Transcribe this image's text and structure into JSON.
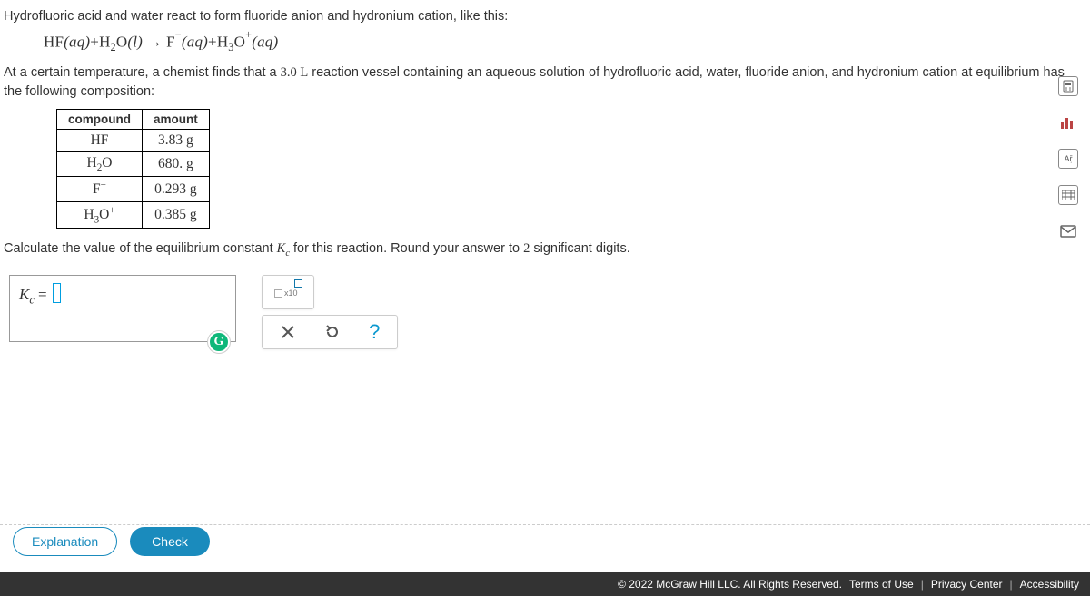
{
  "problem": {
    "intro": "Hydrofluoric acid and water react to form fluoride anion and hydronium cation, like this:",
    "context_pre": "At a certain temperature, a chemist finds that a ",
    "volume": "3.0 L",
    "context_post": " reaction vessel containing an aqueous solution of hydrofluoric acid, water, fluoride anion, and hydronium cation at equilibrium has the following composition:",
    "calc_pre": "Calculate the value of the equilibrium constant ",
    "calc_post": " for this reaction. Round your answer to ",
    "sigdig": "2",
    "calc_end": " significant digits."
  },
  "equation": {
    "r1": "HF",
    "r1_state": "(aq)",
    "plus": "+",
    "r2": "H",
    "r2_sub": "2",
    "r2b": "O",
    "r2_state": "(l)",
    "arrow": "→",
    "p1": "F",
    "p1_sup": "−",
    "p1_state": "(aq)",
    "p2": "H",
    "p2_sub": "3",
    "p2b": "O",
    "p2_sup": "+",
    "p2_state": "(aq)"
  },
  "table": {
    "h1": "compound",
    "h2": "amount",
    "rows": [
      {
        "c": "HF",
        "a": "3.83 g"
      },
      {
        "c": "H2O",
        "a": "680. g"
      },
      {
        "c": "F-",
        "a": "0.293 g"
      },
      {
        "c": "H3O+",
        "a": "0.385 g"
      }
    ]
  },
  "answer": {
    "lhs": "K",
    "lhs_sub": "c",
    "eq": " = "
  },
  "buttons": {
    "explanation": "Explanation",
    "check": "Check"
  },
  "footer": {
    "copyright": "© 2022 McGraw Hill LLC. All Rights Reserved.",
    "terms": "Terms of Use",
    "privacy": "Privacy Center",
    "access": "Accessibility"
  },
  "rail": {
    "calc": "calculator",
    "bars": "chart",
    "ar": "Aṝ",
    "pt": "periodic-table",
    "mail": "mail"
  }
}
